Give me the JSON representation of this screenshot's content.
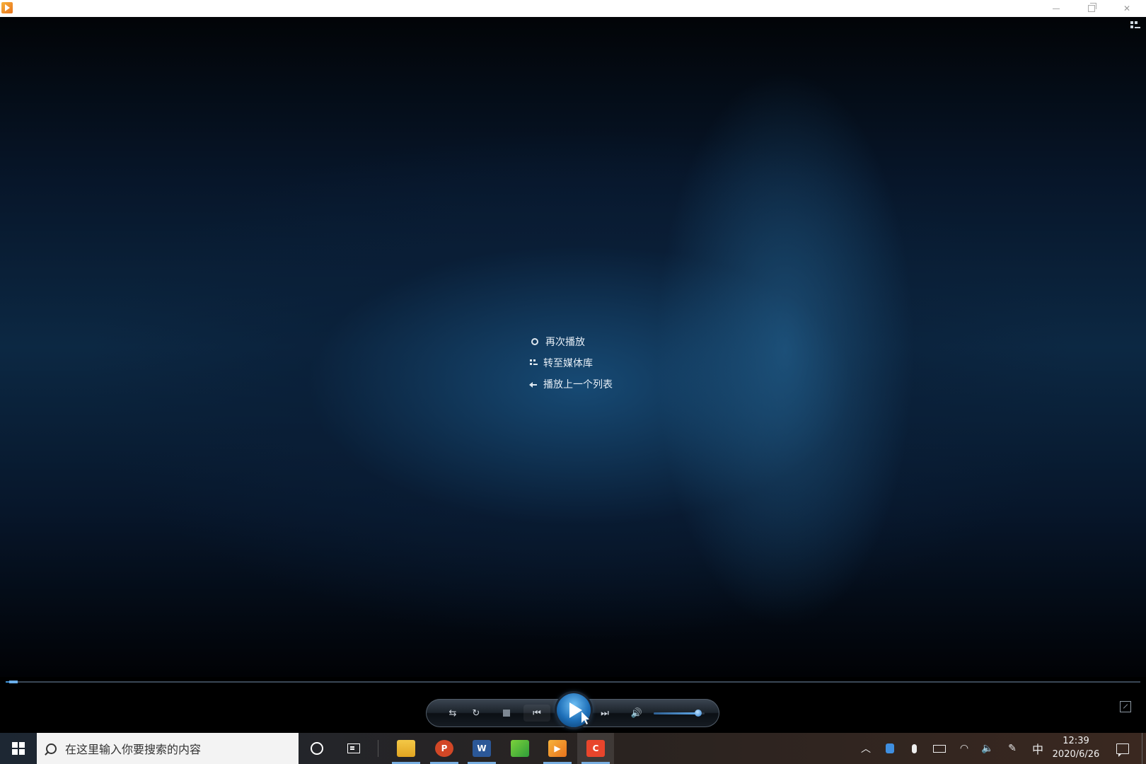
{
  "window": {
    "title": ""
  },
  "end_menu": {
    "items": [
      {
        "label": "再次播放",
        "icon": "replay-icon"
      },
      {
        "label": "转至媒体库",
        "icon": "library-icon"
      },
      {
        "label": "播放上一个列表",
        "icon": "back-arrow-icon"
      }
    ]
  },
  "seek": {
    "progress": 0.007
  },
  "controls": {
    "shuffle_icon": "⇆",
    "repeat_icon": "↻",
    "prev_icon": "⏮",
    "next_icon": "⏭",
    "mute_icon": "🔊",
    "volume": 0.88
  },
  "taskbar": {
    "search_placeholder": "在这里输入你要搜索的内容",
    "apps": [
      {
        "name": "file-explorer",
        "letter": ""
      },
      {
        "name": "powerpoint",
        "letter": "P"
      },
      {
        "name": "word",
        "letter": "W"
      },
      {
        "name": "chart-app",
        "letter": ""
      },
      {
        "name": "media-player",
        "letter": ""
      },
      {
        "name": "camtasia",
        "letter": "C"
      }
    ],
    "ime": "中",
    "clock_time": "12:39",
    "clock_date": "2020/6/26"
  }
}
